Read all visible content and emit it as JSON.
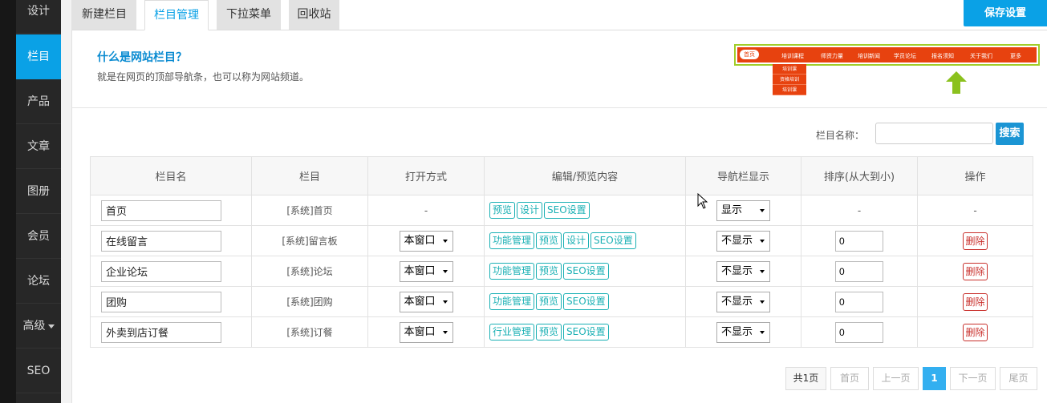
{
  "sidebar": {
    "items": [
      {
        "label": "设计"
      },
      {
        "label": "栏目",
        "active": true
      },
      {
        "label": "产品"
      },
      {
        "label": "文章"
      },
      {
        "label": "图册"
      },
      {
        "label": "会员"
      },
      {
        "label": "论坛"
      },
      {
        "label": "高级"
      },
      {
        "label": "SEO"
      }
    ]
  },
  "tabs": [
    {
      "label": "新建栏目"
    },
    {
      "label": "栏目管理",
      "active": true
    },
    {
      "label": "下拉菜单"
    },
    {
      "label": "回收站"
    }
  ],
  "save_label": "保存设置",
  "intro": {
    "title": "什么是网站栏目？",
    "desc": "就是在网页的顶部导航条，也可以称为网站频道。",
    "nav_demo": [
      "首页",
      "培训课程",
      "师资力量",
      "培训新闻",
      "学员论坛",
      "报名须知",
      "关于我们",
      "更多"
    ],
    "nav_dropdown": [
      "培训课",
      "资格培训",
      "培训课"
    ]
  },
  "search": {
    "label": "栏目名称：",
    "value": "",
    "button": "搜索"
  },
  "table": {
    "headers": [
      "栏目名",
      "栏目",
      "打开方式",
      "编辑/预览内容",
      "导航栏显示",
      "排序(从大到小)",
      "操作"
    ],
    "rows": [
      {
        "name": "首页",
        "column": "[系统]首页",
        "open": "-",
        "actions": [
          "预览",
          "设计",
          "SEO设置"
        ],
        "nav": "显示",
        "order": "-",
        "op": "-"
      },
      {
        "name": "在线留言",
        "column": "[系统]留言板",
        "open": "本窗口",
        "actions": [
          "功能管理",
          "预览",
          "设计",
          "SEO设置"
        ],
        "nav": "不显示",
        "order": "0",
        "op": "删除"
      },
      {
        "name": "企业论坛",
        "column": "[系统]论坛",
        "open": "本窗口",
        "actions": [
          "功能管理",
          "预览",
          "SEO设置"
        ],
        "nav": "不显示",
        "order": "0",
        "op": "删除"
      },
      {
        "name": "团购",
        "column": "[系统]团购",
        "open": "本窗口",
        "actions": [
          "功能管理",
          "预览",
          "SEO设置"
        ],
        "nav": "不显示",
        "order": "0",
        "op": "删除"
      },
      {
        "name": "外卖到店订餐",
        "column": "[系统]订餐",
        "open": "本窗口",
        "actions": [
          "行业管理",
          "预览",
          "SEO设置"
        ],
        "nav": "不显示",
        "order": "0",
        "op": "删除"
      }
    ]
  },
  "pagination": {
    "info": "共1页",
    "first": "首页",
    "prev": "上一页",
    "current": "1",
    "next": "下一页",
    "last": "尾页"
  },
  "colors": {
    "accent": "#0aa1e6",
    "sidebar_bg": "#272727",
    "delete": "#c9302c",
    "action": "#1ab0b4",
    "nav_demo": "#e7420f",
    "arrow": "#8bc11e"
  }
}
